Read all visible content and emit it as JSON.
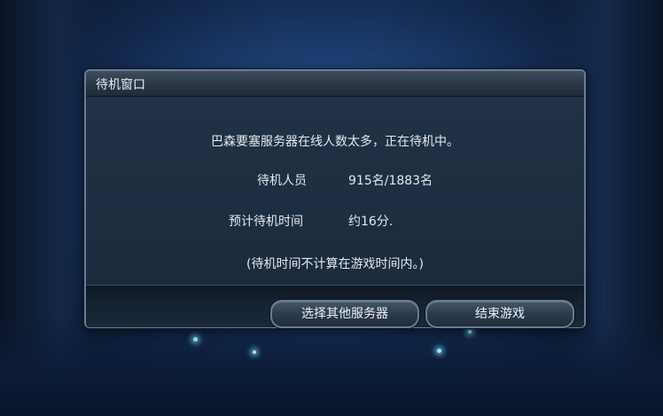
{
  "dialog": {
    "title": "待机窗口",
    "message": "巴森要塞服务器在线人数太多，正在待机中。",
    "queue_label": "待机人员",
    "queue_value": "915名/1883名",
    "wait_label": "预计待机时间",
    "wait_value": "约16分.",
    "note": "(待机时间不计算在游戏时间内。)"
  },
  "buttons": {
    "select_server": "选择其他服务器",
    "exit_game": "结束游戏"
  },
  "colors": {
    "background": "#1d3f72",
    "dialog_body": "#213246",
    "text": "#e4e9ee"
  }
}
